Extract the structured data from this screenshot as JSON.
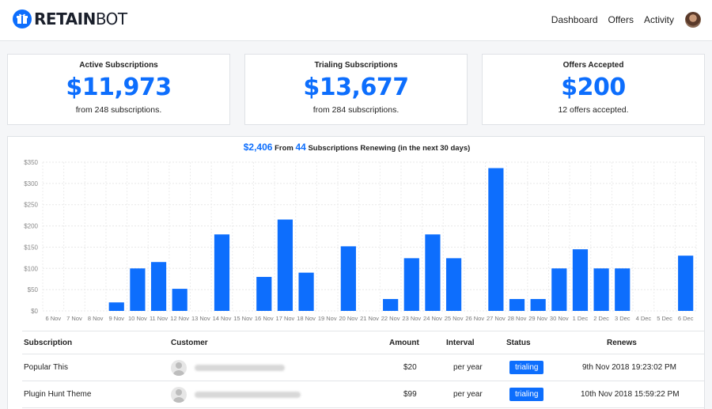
{
  "app": {
    "logo_bold": "RETAIN",
    "logo_light": "BOT",
    "logo_icon": "gift-icon"
  },
  "nav": {
    "links": [
      "Dashboard",
      "Offers",
      "Activity"
    ]
  },
  "cards": [
    {
      "title": "Active Subscriptions",
      "value": "$11,973",
      "sub": "from 248 subscriptions."
    },
    {
      "title": "Trialing Subscriptions",
      "value": "$13,677",
      "sub": "from 284 subscriptions."
    },
    {
      "title": "Offers Accepted",
      "value": "$200",
      "sub": "12 offers accepted."
    }
  ],
  "renewing": {
    "amount": "$2,406",
    "from_text": "From",
    "count": "44",
    "suffix": "Subscriptions Renewing (in the next 30 days)"
  },
  "chart_data": {
    "type": "bar",
    "categories": [
      "6 Nov",
      "7 Nov",
      "8 Nov",
      "9 Nov",
      "10 Nov",
      "11 Nov",
      "12 Nov",
      "13 Nov",
      "14 Nov",
      "15 Nov",
      "16 Nov",
      "17 Nov",
      "18 Nov",
      "19 Nov",
      "20 Nov",
      "21 Nov",
      "22 Nov",
      "23 Nov",
      "24 Nov",
      "25 Nov",
      "26 Nov",
      "27 Nov",
      "28 Nov",
      "29 Nov",
      "30 Nov",
      "1 Dec",
      "2 Dec",
      "3 Dec",
      "4 Dec",
      "5 Dec",
      "6 Dec"
    ],
    "values": [
      0,
      0,
      0,
      20,
      100,
      115,
      52,
      0,
      180,
      0,
      80,
      215,
      90,
      0,
      152,
      0,
      28,
      124,
      180,
      124,
      0,
      336,
      28,
      28,
      100,
      145,
      100,
      100,
      0,
      0,
      130
    ],
    "ylim": [
      0,
      350
    ],
    "yticks": [
      0,
      50,
      100,
      150,
      200,
      250,
      300,
      350
    ],
    "ytick_labels": [
      "$0",
      "$50",
      "$100",
      "$150",
      "$200",
      "$250",
      "$300",
      "$350"
    ],
    "grid": true,
    "color": "#0d6efd"
  },
  "table": {
    "headers": {
      "subscription": "Subscription",
      "customer": "Customer",
      "amount": "Amount",
      "interval": "Interval",
      "status": "Status",
      "renews": "Renews"
    },
    "rows": [
      {
        "subscription": "Popular This",
        "amount": "$20",
        "interval": "per year",
        "status": "trialing",
        "renews": "9th Nov 2018 19:23:02 PM"
      },
      {
        "subscription": "Plugin Hunt Theme",
        "amount": "$99",
        "interval": "per year",
        "status": "trialing",
        "renews": "10th Nov 2018 15:59:22 PM"
      }
    ]
  }
}
